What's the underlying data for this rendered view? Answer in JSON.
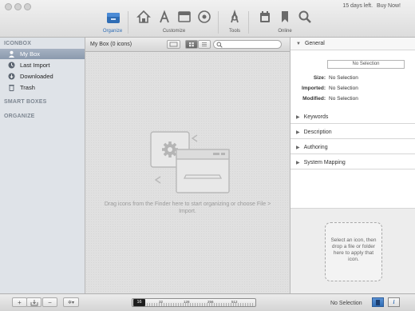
{
  "titlebar": {
    "trial_text": "15 days left.",
    "buy_link": "Buy Now!"
  },
  "toolbar": {
    "groups": [
      {
        "label": "Organize",
        "active": true,
        "icons": [
          "organize-box-icon"
        ]
      },
      {
        "label": "Customize",
        "icons": [
          "home-icon",
          "app-store-icon",
          "window-icon",
          "disk-icon"
        ]
      },
      {
        "label": "Tools",
        "icons": [
          "tools-icon"
        ]
      },
      {
        "label": "Online",
        "icons": [
          "calendar-icon",
          "bookmark-icon",
          "magnifier-icon"
        ]
      }
    ]
  },
  "sidebar": {
    "sections": [
      {
        "title": "ICONBOX"
      },
      {
        "title": "SMART BOXES"
      },
      {
        "title": "ORGANIZE"
      }
    ],
    "items": [
      {
        "label": "My Box",
        "icon": "user-icon",
        "selected": true
      },
      {
        "label": "Last Import",
        "icon": "clock-icon"
      },
      {
        "label": "Downloaded",
        "icon": "download-icon"
      },
      {
        "label": "Trash",
        "icon": "trash-icon"
      }
    ]
  },
  "center": {
    "title": "My Box (0 icons)",
    "search_placeholder": "",
    "empty_message": "Drag icons from the Finder here to start organizing or choose File > Import."
  },
  "inspector": {
    "general_title": "General",
    "selection_field": "No Selection",
    "props": [
      {
        "label": "Size:",
        "value": "No Selection"
      },
      {
        "label": "Imported:",
        "value": "No Selection"
      },
      {
        "label": "Modified:",
        "value": "No Selection"
      }
    ],
    "sections": [
      "Keywords",
      "Description",
      "Authoring",
      "System Mapping"
    ],
    "hint": "Select an icon, then drop a file or folder here to apply that icon."
  },
  "bottombar": {
    "size_value": "16",
    "tick_labels": [
      "32",
      "128",
      "256",
      "512"
    ],
    "status": "No Selection"
  },
  "colors": {
    "accent": "#2f6db5",
    "selection": "#8a99ad"
  }
}
